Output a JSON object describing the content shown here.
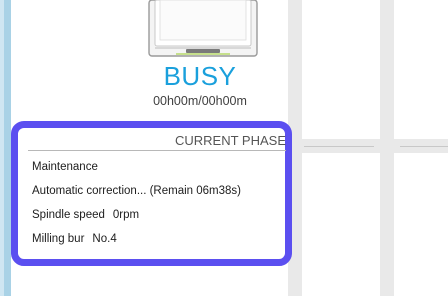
{
  "machine": {
    "status": "BUSY",
    "timer": "00h00m/00h00m",
    "icon": "milling-machine-icon"
  },
  "phase": {
    "header": "CURRENT PHASE",
    "mode": "Maintenance",
    "task": "Automatic correction... (Remain 06m38s)",
    "spindle_label": "Spindle speed",
    "spindle_value": "0rpm",
    "bur_label": "Milling bur",
    "bur_value": "No.4"
  },
  "colors": {
    "accent": "#5b4ff0",
    "status": "#1aa0dc",
    "rail": "#a9d2e6"
  }
}
